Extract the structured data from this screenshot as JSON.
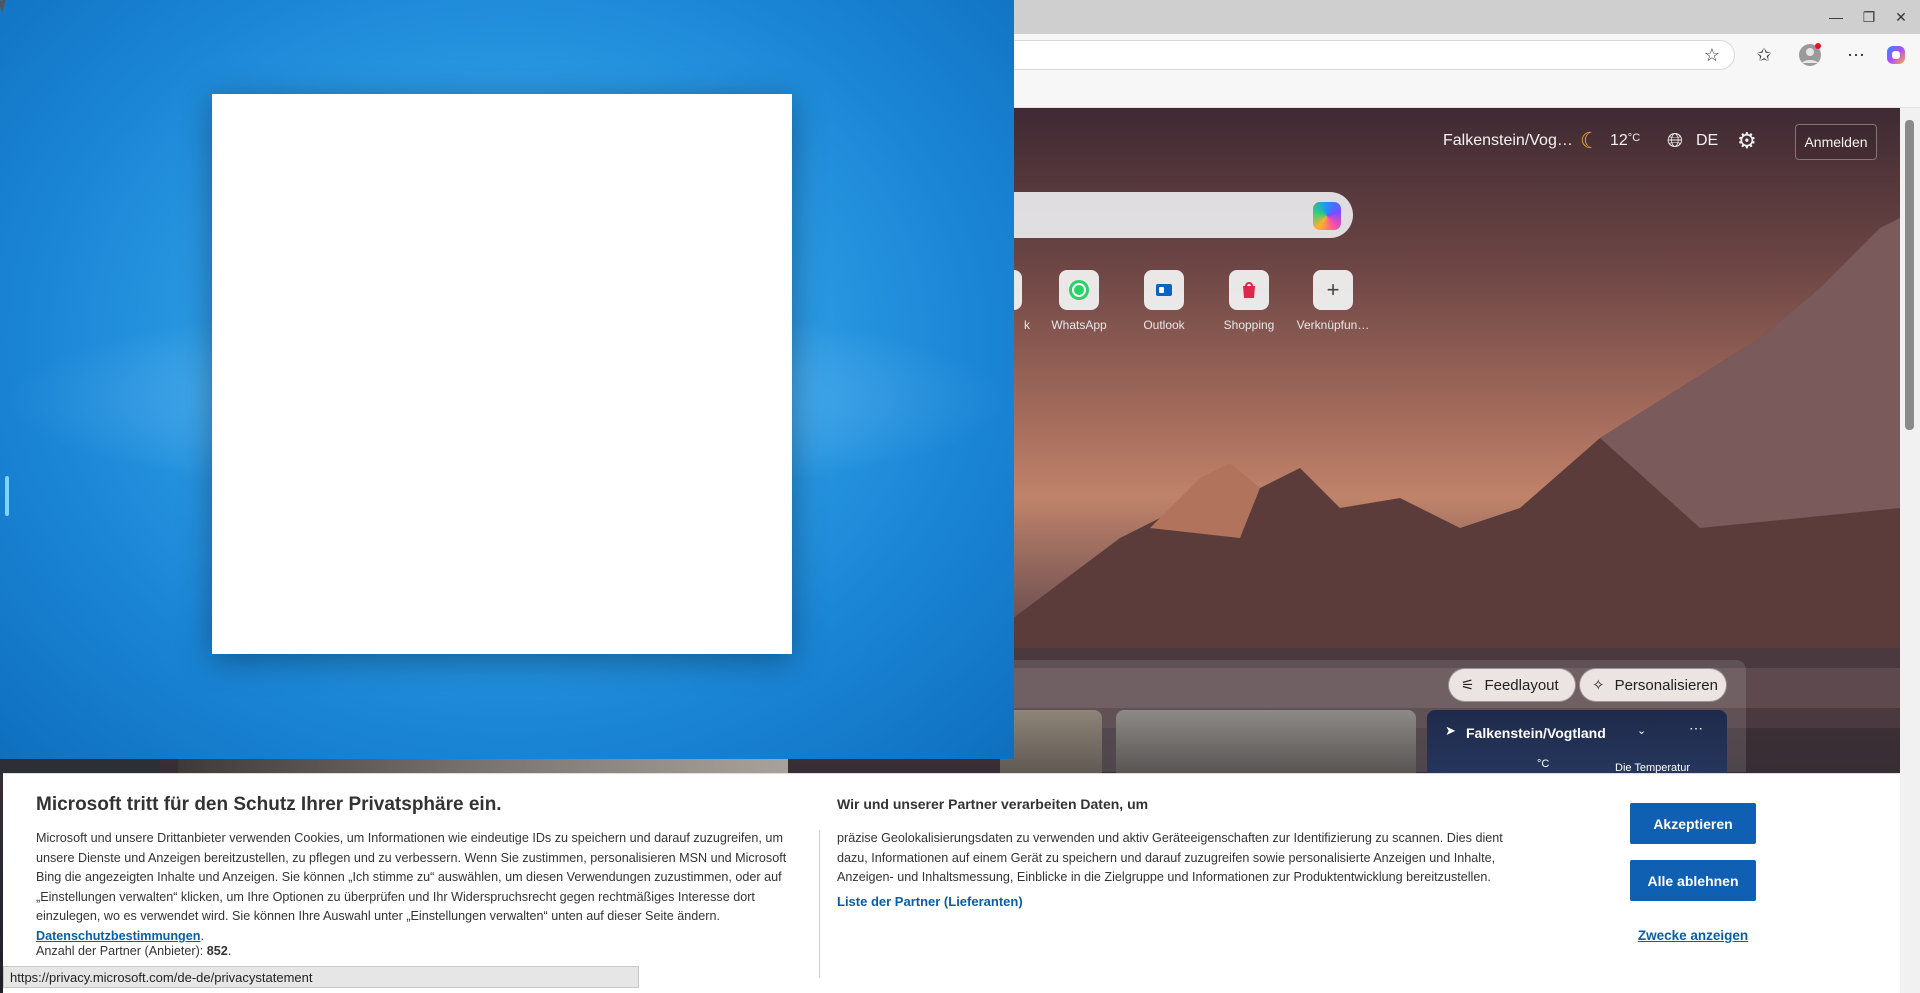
{
  "browser": {
    "window_controls": {
      "minimize": "—",
      "restore": "❐",
      "close": "✕"
    },
    "toolbar_icons": [
      "favorite-star-icon",
      "favorites-icon",
      "profile-icon",
      "more-icon",
      "copilot-icon"
    ]
  },
  "page_header": {
    "location": "Falkenstein/Vog…",
    "temperature": "12",
    "temp_unit": "°C",
    "language": "DE",
    "signin_label": "Anmelden"
  },
  "quick_links": [
    {
      "label": "k",
      "icon": "partial-icon"
    },
    {
      "label": "WhatsApp",
      "icon": "whatsapp-icon"
    },
    {
      "label": "Outlook",
      "icon": "outlook-icon"
    },
    {
      "label": "Shopping",
      "icon": "shopping-icon"
    },
    {
      "label": "Verknüpfun…",
      "icon": "plus-icon"
    }
  ],
  "feed": {
    "layout_label": "Feedlayout",
    "personalize_label": "Personalisieren"
  },
  "weather_card": {
    "location": "Falkenstein/Vogtland",
    "temp_unit": "°C",
    "snippet": "Die Temperatur"
  },
  "consent": {
    "title": "Microsoft tritt für den Schutz Ihrer Privatsphäre ein.",
    "body": "Microsoft und unsere Drittanbieter verwenden Cookies, um Informationen wie eindeutige IDs zu speichern und darauf zuzugreifen, um unsere Dienste und Anzeigen bereitzustellen, zu pflegen und zu verbessern. Wenn Sie zustimmen, personalisieren MSN und Microsoft Bing die angezeigten Inhalte und Anzeigen. Sie können „Ich stimme zu“ auswählen, um diesen Verwendungen zuzustimmen, oder auf „Einstellungen verwalten“ klicken, um Ihre Optionen zu überprüfen und Ihr Widerspruchsrecht gegen rechtmäßiges Interesse dort einzulegen, wo es verwendet wird.  Sie können Ihre Auswahl unter „Einstellungen verwalten“ unten auf dieser Seite ändern. ",
    "privacy_link": "Datenschutzbestimmungen",
    "partner_count_label": "Anzahl der Partner (Anbieter): ",
    "partner_count": "852",
    "purposes_title": "Wir und unserer Partner verarbeiten Daten, um",
    "purposes_body": "präzise Geolokalisierungsdaten zu verwenden und aktiv Geräteeigenschaften zur Identifizierung zu scannen. Dies dient dazu, Informationen auf einem Gerät zu speichern und darauf zuzugreifen sowie personalisierte Anzeigen und Inhalte, Anzeigen- und Inhaltsmessung, Einblicke in die Zielgruppe und Informationen zur Produktentwicklung bereitzustellen.",
    "vendors_link": "Liste der Partner (Lieferanten)",
    "accept_label": "Akzeptieren",
    "reject_label": "Alle ablehnen",
    "purposes_link": "Zwecke anzeigen"
  },
  "status_url": "https://privacy.microsoft.com/de-de/privacystatement"
}
